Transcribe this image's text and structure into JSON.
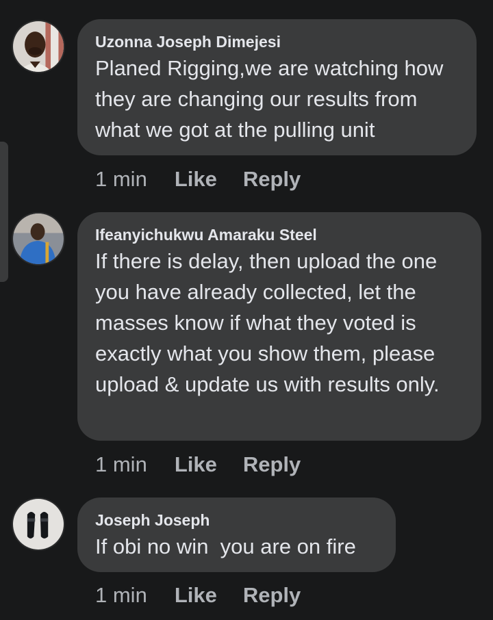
{
  "comments": [
    {
      "author": "Uzonna Joseph Dimejesi",
      "text": "Planed Rigging,we are watching how they are changing our results from what we got at the pulling unit",
      "time": "1 min",
      "like_label": "Like",
      "reply_label": "Reply"
    },
    {
      "author": "Ifeanyichukwu Amaraku Steel",
      "text": "If there is delay, then upload the one you have already collected, let the masses know if what they voted is exactly what you show them, please upload & update us with results only.",
      "time": "1 min",
      "like_label": "Like",
      "reply_label": "Reply"
    },
    {
      "author": "Joseph Joseph",
      "text": "If obi no win  you are on fire",
      "time": "1 min",
      "like_label": "Like",
      "reply_label": "Reply"
    }
  ],
  "colors": {
    "background": "#18191a",
    "bubble": "#3a3b3c",
    "primary_text": "#e4e6eb",
    "secondary_text": "#b0b3b8"
  }
}
